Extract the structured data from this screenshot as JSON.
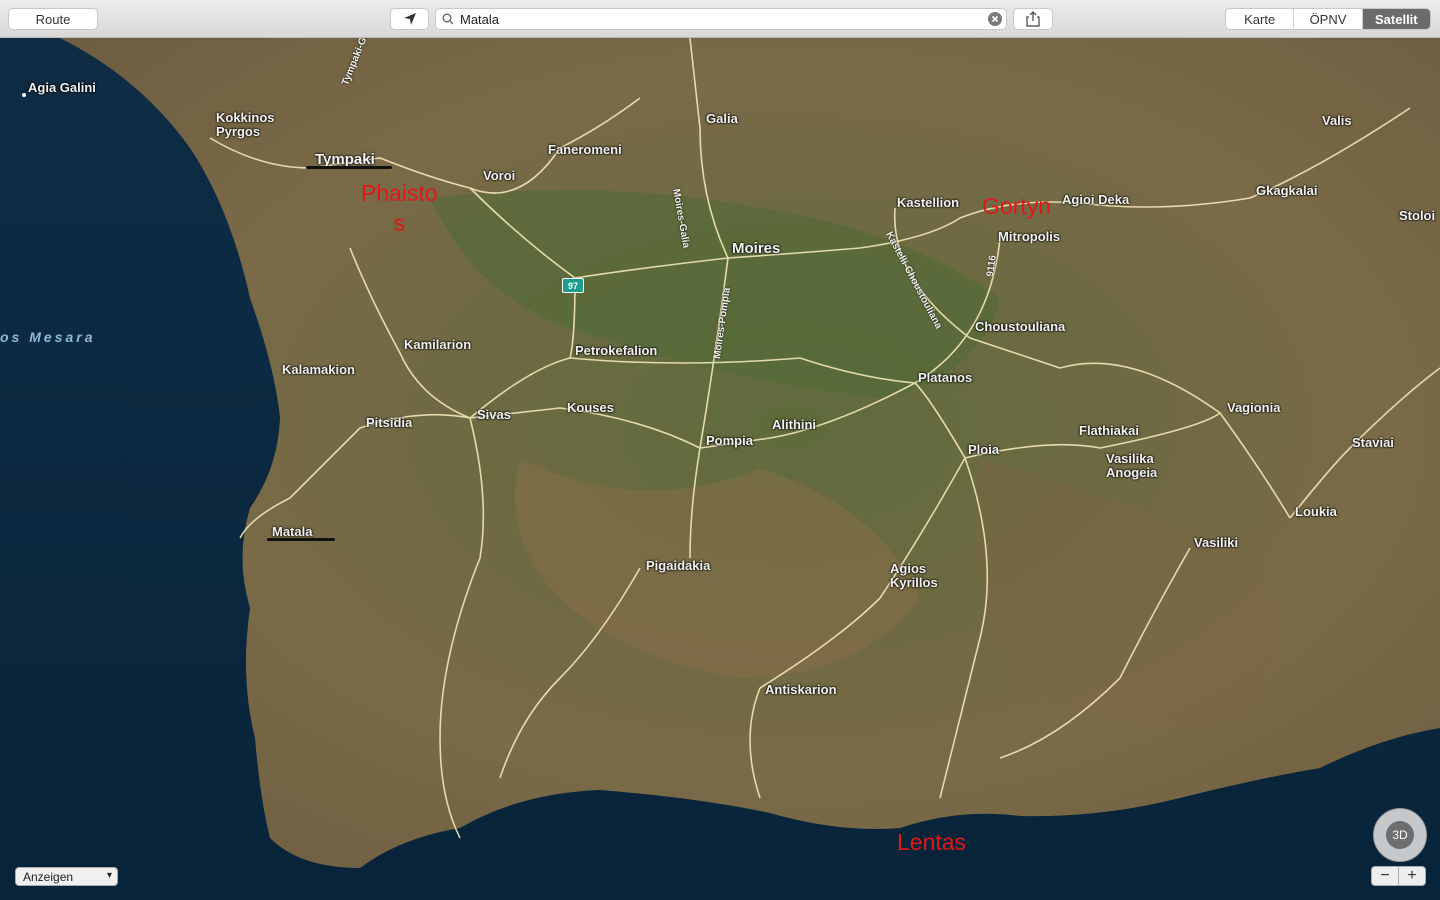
{
  "toolbar": {
    "route_label": "Route",
    "search_value": "Matala",
    "map_types": [
      "Karte",
      "ÖPNV",
      "Satellit"
    ],
    "active_map_type": "Satellit"
  },
  "map": {
    "sea_label": "os Mesara",
    "road_shield": "97",
    "places": {
      "agia_galini": "Agia Galini",
      "kokkinos_pyrgos": "Kokkinos\nPyrgos",
      "tympaki": "Tympaki",
      "voroi": "Voroi",
      "faneromeni": "Faneromeni",
      "galia": "Galia",
      "moires": "Moires",
      "kastellion": "Kastellion",
      "agioi_deka": "Agioi Deka",
      "mitropolis": "Mitropolis",
      "gkagkalai": "Gkagkalai",
      "valis": "Valis",
      "stoloi": "Stoloi",
      "kamilarion": "Kamilarion",
      "petrokefalion": "Petrokefalion",
      "choustouliana": "Choustouliana",
      "kalamakion": "Kalamakion",
      "platanos": "Platanos",
      "sivas": "Sivas",
      "kouses": "Kouses",
      "pitsidia": "Pitsidia",
      "alithini": "Alithini",
      "pompia": "Pompia",
      "vagionia": "Vagionia",
      "flathiakai": "Flathiakai",
      "ploia": "Ploia",
      "vasilika_anogeia": "Vasilika\nAnogeia",
      "staviai": "Staviai",
      "loukia": "Loukia",
      "vasiliki": "Vasiliki",
      "matala": "Matala",
      "pigaidakia": "Pigaidakia",
      "agios_kyrillos": "Agios\nKyrillos",
      "antiskarion": "Antiskarion"
    },
    "road_labels": {
      "tympaki_grigoria": "Tympaki-Grigoria",
      "moires_galia": "Moires-Galia",
      "moires_pompia": "Moires-Pompia",
      "kastelli_choustouliana": "Kastelli-Choustouliana",
      "r9116": "9116"
    },
    "annotations": {
      "phaistos": "Phaisto\ns",
      "gortyn": "Gortyn",
      "lentas": "Lentas"
    }
  },
  "controls": {
    "compass_label": "3D",
    "zoom_out": "−",
    "zoom_in": "+",
    "show_label": "Anzeigen"
  },
  "colors": {
    "annotation_red": "#e01818",
    "sea_dark": "#0c2740",
    "land": "#6b6a45"
  }
}
